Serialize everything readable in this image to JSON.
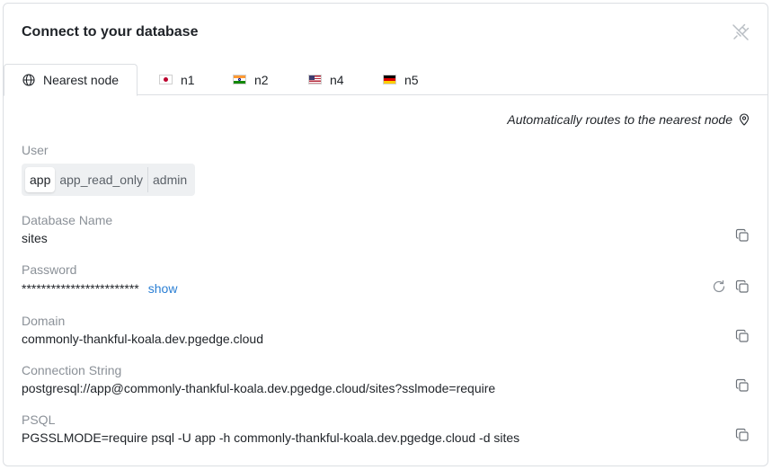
{
  "title": "Connect to your database",
  "tabs": [
    {
      "label": "Nearest node",
      "icon": "globe-icon"
    },
    {
      "label": "n1",
      "icon": "flag-japan"
    },
    {
      "label": "n2",
      "icon": "flag-india"
    },
    {
      "label": "n4",
      "icon": "flag-usa"
    },
    {
      "label": "n5",
      "icon": "flag-germany"
    }
  ],
  "route_note": "Automatically routes to the nearest node",
  "user": {
    "label": "User",
    "options": [
      "app",
      "app_read_only",
      "admin"
    ],
    "selected": "app"
  },
  "database_name": {
    "label": "Database Name",
    "value": "sites"
  },
  "password": {
    "label": "Password",
    "value": "************************",
    "show_label": "show"
  },
  "domain": {
    "label": "Domain",
    "value": "commonly-thankful-koala.dev.pgedge.cloud"
  },
  "connection_string": {
    "label": "Connection String",
    "value": "postgresql://app@commonly-thankful-koala.dev.pgedge.cloud/sites?sslmode=require"
  },
  "psql": {
    "label": "PSQL",
    "value": "PGSSLMODE=require psql -U app -h commonly-thankful-koala.dev.pgedge.cloud -d sites"
  },
  "colors": {
    "link": "#2b7fd4",
    "muted": "#8b9198",
    "border": "#dcdfe3"
  }
}
